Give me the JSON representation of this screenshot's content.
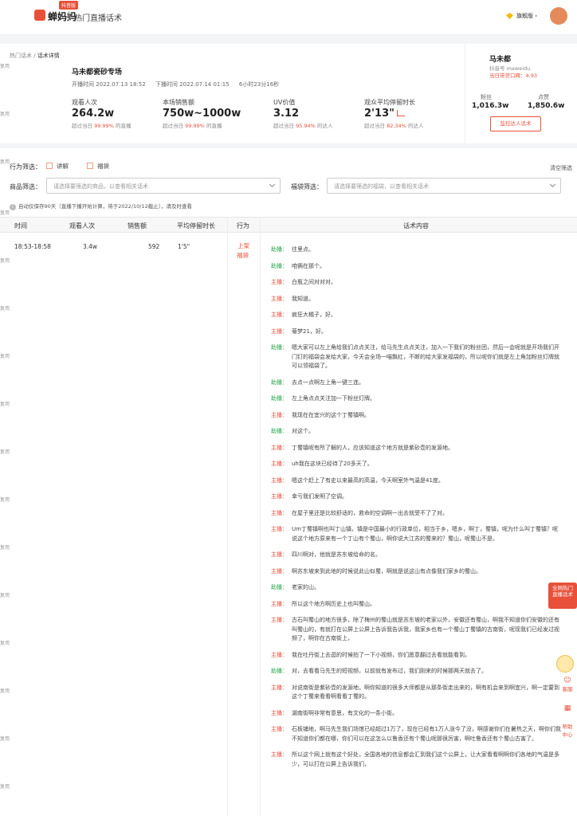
{
  "header": {
    "logo_text": "蝉妈妈",
    "logo_badge": "抖音版",
    "app_title": "热门直播话术",
    "vip_label": "旗舰版",
    "vip_caret": "›"
  },
  "breadcrumb": {
    "parent": "热门话术",
    "sep": " / ",
    "current": "话术详情"
  },
  "room": {
    "title": "马未都瓷砂专场",
    "start": "开播时间  2022.07.13 18:52",
    "end": "下播时间  2022.07.14 01:15",
    "duration": "6小时23分16秒"
  },
  "stats": [
    {
      "label": "观看人次",
      "value": "264.2w",
      "sub_prefix": "超过当日",
      "pct": "99.99%",
      "sub_suffix": "的直播"
    },
    {
      "label": "本场销售额",
      "value": "750w~1000w",
      "sub_prefix": "超过当日",
      "pct": "99.99%",
      "sub_suffix": "的直播"
    },
    {
      "label": "UV价值",
      "value": "3.12",
      "sub_prefix": "超过当日",
      "pct": "95.94%",
      "sub_suffix": "的达人"
    },
    {
      "label": "观众平均停留时长",
      "value": "2'13\"",
      "sub_prefix": "超过当日",
      "pct": "82.34%",
      "sub_suffix": "的达人"
    }
  ],
  "streamer": {
    "name": "马未都",
    "id": "抖音号 maweidu",
    "score": "当日带货口碑：4.93",
    "fans_label": "粉丝",
    "fans": "1,016.3w",
    "likes_label": "点赞",
    "likes": "1,850.6w",
    "monitor_button": "监控达人话术"
  },
  "filters": {
    "behavior_label": "行为筛选：",
    "opt_explain": "讲解",
    "opt_bag": "福袋",
    "clear": "清空筛选",
    "product_label": "商品筛选：",
    "product_placeholder": "请选择要筛选的商品，以查看相关话术",
    "bag_label": "福袋筛选：",
    "bag_placeholder": "请选择要筛选的福袋，以查看相关话术",
    "note": "自动仅保存90天（直播下播开始计算，将于2022/10/12截止），请及时查看"
  },
  "table": {
    "headers": [
      "时间",
      "观看人次",
      "销售额",
      "平均停留时长",
      "行为",
      "话术内容"
    ],
    "row": {
      "time": "18:53-18:58",
      "views": "3.4w",
      "sales": "592",
      "stay": "1'5\"",
      "action_1": "上架",
      "action_2": "福袋"
    },
    "lines": [
      {
        "speaker": "助播：",
        "role": "assist",
        "text": "往里点。"
      },
      {
        "speaker": "助播：",
        "role": "assist",
        "text": "咱俩在那个。"
      },
      {
        "speaker": "主播：",
        "role": "host",
        "text": "白瓶之间对对对。"
      },
      {
        "speaker": "主播：",
        "role": "host",
        "text": "我知道。"
      },
      {
        "speaker": "主播：",
        "role": "host",
        "text": "疯狂大橘子，好。"
      },
      {
        "speaker": "主播：",
        "role": "host",
        "text": "菊梦21，好。"
      },
      {
        "speaker": "助播：",
        "role": "assist",
        "text": "嗯大家可以左上角给我们点点关注，给马先生点点关注，加入一下我们的粉丝团，然后一会呢就是开场我们开门钉的福袋会发给大家，今天会全场一喵飘红，不断的给大家发福袋的，所以呢你们就是左上角加粉丝灯牌就可以领福袋了。"
      },
      {
        "speaker": "助播：",
        "role": "assist",
        "text": "去点一点啊左上角一键三连。"
      },
      {
        "speaker": "助播：",
        "role": "assist",
        "text": "左上角点点关注加一下粉丝灯牌。"
      },
      {
        "speaker": "主播：",
        "role": "host",
        "text": "我现在在宜兴的这个丁蜀镇啊。"
      },
      {
        "speaker": "助播：",
        "role": "assist",
        "text": "对这个。"
      },
      {
        "speaker": "主播：",
        "role": "host",
        "text": "丁蜀镇呢有所了解的人，应该知道这个地方就是紫砂壶的发源地。"
      },
      {
        "speaker": "主播：",
        "role": "host",
        "text": "uh我在这块已经待了20多天了。"
      },
      {
        "speaker": "主播：",
        "role": "host",
        "text": "嗯这个赶上了有史以来最高的高温，今天啊室外气温是41度。"
      },
      {
        "speaker": "主播：",
        "role": "host",
        "text": "幸亏我们发明了空调。"
      },
      {
        "speaker": "主播：",
        "role": "host",
        "text": "在屋子里还是比较舒适的，救命的空调啊一出去就受不了了对。"
      },
      {
        "speaker": "主播：",
        "role": "host",
        "text": "Um丁蜀镇啊也叫丁山镇，镇是中国最小的行政单位，相当于乡，嗯乡，啊丁，蜀镇，呢为什么叫丁蜀镇？呢说这个地方原来有一个丁山有个蜀山，啊你说大江苏的蜀来的？蜀山，呢蜀山不是。"
      },
      {
        "speaker": "主播：",
        "role": "host",
        "text": "四川啊对，他就是苏东坡给命的名。"
      },
      {
        "speaker": "主播：",
        "role": "host",
        "text": "啊苏东坡来到此地的时候说此山似蜀，啊就是说这山有点像我们家乡的蜀山。"
      },
      {
        "speaker": "助播：",
        "role": "assist",
        "text": "老家的山。"
      },
      {
        "speaker": "主播：",
        "role": "host",
        "text": "所以这个地方啊历史上也叫蜀山。"
      },
      {
        "speaker": "主播：",
        "role": "host",
        "text": "古石叫蜀山的地方很多，除了梅州的蜀山就是苏东坡的老家以外，安徽还有蜀山，啊我不知道你们安徽的还有叫蜀山的，有就打在公屏上公屏上告诉我告诉我，我家乡也有一个蜀山丁蜀镇的古南街，呢现我们已经发过视频了，啊你在古南街上，"
      },
      {
        "speaker": "主播：",
        "role": "host",
        "text": "我在吐丹街上去逛的时候拍了一下小视频，你们愿意翻过去看就能看到。"
      },
      {
        "speaker": "助播：",
        "role": "assist",
        "text": "对，去看看马先生的短视频，以前就有发布过，我们刚来的时候那两天就去了。"
      },
      {
        "speaker": "主播：",
        "role": "host",
        "text": "对说南街是紫砂壶的发源地，啊你知道的很多大师都是从那条街走出来的，啊有机会来到啊宜兴，啊一定要到这个丁蜀来看看啊看看丁蜀的。"
      },
      {
        "speaker": "主播：",
        "role": "host",
        "text": "湖南街啊非常有意思，有文化的一条小街。"
      },
      {
        "speaker": "主播：",
        "role": "host",
        "text": "石板铺地，啊马先生我们场馆已经超过1万了，现在已经有1万人涨今了没，啊感谢你们在暑热之天，啊你们我不知道你们都在哪，你们可以在这怎么以鲁香还有个蜀山呢那很厉害，啊吐鲁香还有个蜀山古害了。"
      },
      {
        "speaker": "主播：",
        "role": "host",
        "text": "所以这个网上就有这个好处，全国各地的信息都会汇到我们这个公屏上，让大家看看啊啊你们各地的气温是多少，可以打在公屏上告诉我们，"
      }
    ]
  },
  "floats": {
    "hot_1": "全网热门",
    "hot_2": "直播话术",
    "support": "客服",
    "help_1": "帮助",
    "help_2": "中心"
  },
  "side_mark": "复用",
  "colors": {
    "accent": "#e8503a",
    "assist": "#2aa54a",
    "bg": "#f4f5f7"
  }
}
